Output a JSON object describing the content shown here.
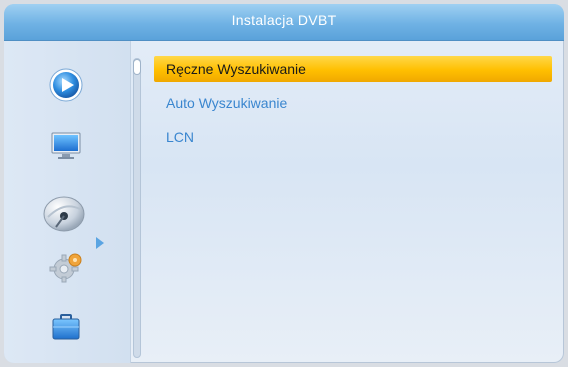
{
  "title": "Instalacja DVBT",
  "sidebar": {
    "items": [
      {
        "icon": "play-icon"
      },
      {
        "icon": "tv-icon"
      },
      {
        "icon": "satellite-dish-icon",
        "selected": true
      },
      {
        "icon": "settings-gear-icon"
      },
      {
        "icon": "toolbox-icon"
      }
    ]
  },
  "menu": {
    "items": [
      {
        "label": "Ręczne Wyszukiwanie",
        "selected": true
      },
      {
        "label": "Auto Wyszukiwanie",
        "selected": false
      },
      {
        "label": "LCN",
        "selected": false
      }
    ]
  },
  "colors": {
    "titlebar": "#6fb2e4",
    "highlight": "#ffc200",
    "menu_text": "#3a86cf"
  }
}
